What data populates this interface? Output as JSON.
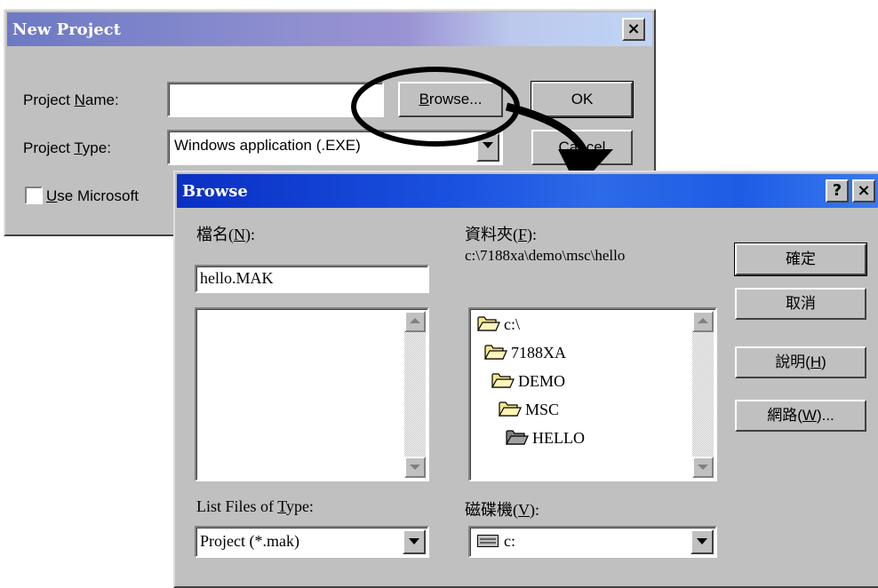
{
  "new_project": {
    "title": "New Project",
    "close_glyph": "×",
    "name_label_pre": "Project ",
    "name_label_key": "N",
    "name_label_post": "ame:",
    "name_value": "",
    "type_label_pre": "Project ",
    "type_label_key": "T",
    "type_label_post": "ype:",
    "type_value": "Windows application (.EXE)",
    "browse_key": "B",
    "browse_rest": "rowse...",
    "ok_label": "OK",
    "cancel_label": "Cancel",
    "checkbox_key": "U",
    "checkbox_rest": "se Microsoft"
  },
  "browse": {
    "title": "Browse",
    "help_glyph": "?",
    "close_glyph": "×",
    "filename_label_pre": "檔名(",
    "filename_label_key": "N",
    "filename_label_post": "):",
    "filename_value": "hello.MAK",
    "folder_label_pre": "資料夾(",
    "folder_label_key": "F",
    "folder_label_post": "):",
    "current_path": "c:\\7188xa\\demo\\msc\\hello",
    "folders": [
      {
        "name": "c:\\",
        "open": true
      },
      {
        "name": "7188XA",
        "open": true
      },
      {
        "name": "DEMO",
        "open": true
      },
      {
        "name": "MSC",
        "open": true
      },
      {
        "name": "HELLO",
        "open": true,
        "selected": true
      }
    ],
    "filetype_label_pre": "List Files of ",
    "filetype_label_key": "T",
    "filetype_label_post": "ype:",
    "filetype_value": "Project (*.mak)",
    "drives_label_pre": "磁碟機(",
    "drives_label_key": "V",
    "drives_label_post": "):",
    "drive_value": "c:",
    "buttons": {
      "ok": "確定",
      "cancel": "取消",
      "help_pre": "說明(",
      "help_key": "H",
      "help_post": ")",
      "network_pre": "網路(",
      "network_key": "W",
      "network_post": ")..."
    }
  },
  "colors": {
    "dialog_face": "#c0c0c0",
    "titlebar_gradient": "#000080"
  }
}
